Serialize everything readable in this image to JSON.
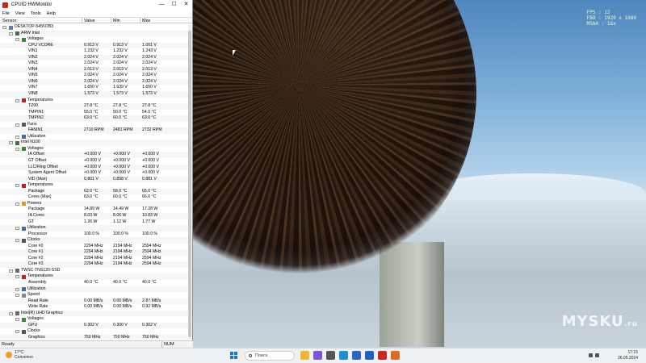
{
  "window": {
    "title": "CPUID HWMonitor"
  },
  "menu": [
    "File",
    "View",
    "Tools",
    "Help"
  ],
  "columns": [
    "Sensor",
    "Value",
    "Min",
    "Max"
  ],
  "tree": [
    {
      "level": 0,
      "type": "computer",
      "name": "DESKTOP-545N7B3"
    },
    {
      "level": 1,
      "type": "board",
      "name": "ARW Intel"
    },
    {
      "level": 2,
      "type": "volt",
      "name": "Voltages"
    },
    {
      "level": 3,
      "name": "CPU VCORE",
      "value": "0.913 V",
      "min": "0.913 V",
      "max": "1.001 V"
    },
    {
      "level": 3,
      "name": "VIN1",
      "value": "1.232 V",
      "min": "1.232 V",
      "max": "1.243 V"
    },
    {
      "level": 3,
      "name": "VIN2",
      "value": "2.024 V",
      "min": "2.024 V",
      "max": "2.024 V"
    },
    {
      "level": 3,
      "name": "VIN3",
      "value": "2.024 V",
      "min": "2.024 V",
      "max": "2.024 V"
    },
    {
      "level": 3,
      "name": "VIN4",
      "value": "2.013 V",
      "min": "2.013 V",
      "max": "2.013 V"
    },
    {
      "level": 3,
      "name": "VIN5",
      "value": "2.024 V",
      "min": "2.024 V",
      "max": "2.024 V"
    },
    {
      "level": 3,
      "name": "VIN6",
      "value": "2.024 V",
      "min": "2.024 V",
      "max": "2.024 V"
    },
    {
      "level": 3,
      "name": "VIN7",
      "value": "1.650 V",
      "min": "1.639 V",
      "max": "1.650 V"
    },
    {
      "level": 3,
      "name": "VIN8",
      "value": "1.573 V",
      "min": "1.573 V",
      "max": "1.573 V"
    },
    {
      "level": 2,
      "type": "temp",
      "name": "Temperatures"
    },
    {
      "level": 3,
      "name": "TZ00",
      "value": "27.8 °C",
      "min": "27.8 °C",
      "max": "27.8 °C"
    },
    {
      "level": 3,
      "name": "TMPIN1",
      "value": "55.0 °C",
      "min": "50.0 °C",
      "max": "54.0 °C"
    },
    {
      "level": 3,
      "name": "TMPIN2",
      "value": "63.0 °C",
      "min": "60.0 °C",
      "max": "63.0 °C"
    },
    {
      "level": 2,
      "type": "fan",
      "name": "Fans"
    },
    {
      "level": 3,
      "name": "FANIN1",
      "value": "2710 RPM",
      "min": "2481 RPM",
      "max": "2732 RPM"
    },
    {
      "level": 2,
      "type": "util",
      "name": "Utilization"
    },
    {
      "level": 1,
      "type": "cpu",
      "name": "Intel N100"
    },
    {
      "level": 2,
      "type": "volt",
      "name": "Voltages"
    },
    {
      "level": 3,
      "name": "IA Offset",
      "value": "+0.000 V",
      "min": "+0.000 V",
      "max": "+0.000 V"
    },
    {
      "level": 3,
      "name": "GT Offset",
      "value": "+0.000 V",
      "min": "+0.000 V",
      "max": "+0.000 V"
    },
    {
      "level": 3,
      "name": "LLC/Ring Offset",
      "value": "+0.000 V",
      "min": "+0.000 V",
      "max": "+0.000 V"
    },
    {
      "level": 3,
      "name": "System Agent Offset",
      "value": "+0.000 V",
      "min": "+0.000 V",
      "max": "+0.000 V"
    },
    {
      "level": 3,
      "name": "VID (Max)",
      "value": "0.801 V",
      "min": "0.898 V",
      "max": "0.881 V"
    },
    {
      "level": 2,
      "type": "temp",
      "name": "Temperatures"
    },
    {
      "level": 3,
      "name": "Package",
      "value": "62.0 °C",
      "min": "58.0 °C",
      "max": "65.0 °C"
    },
    {
      "level": 3,
      "name": "Cores (Max)",
      "value": "63.0 °C",
      "min": "60.0 °C",
      "max": "66.0 °C"
    },
    {
      "level": 2,
      "type": "power",
      "name": "Powers"
    },
    {
      "level": 3,
      "name": "Package",
      "value": "14.89 W",
      "min": "14.49 W",
      "max": "17.28 W"
    },
    {
      "level": 3,
      "name": "IA Cores",
      "value": "8.03 W",
      "min": "8.06 W",
      "max": "10.83 W"
    },
    {
      "level": 3,
      "name": "GT",
      "value": "1.26 W",
      "min": "1.12 W",
      "max": "1.77 W"
    },
    {
      "level": 2,
      "type": "util",
      "name": "Utilization"
    },
    {
      "level": 3,
      "name": "Processor",
      "value": "100.0 %",
      "min": "100.0 %",
      "max": "100.0 %"
    },
    {
      "level": 2,
      "type": "clock",
      "name": "Clocks"
    },
    {
      "level": 3,
      "name": "Core #0",
      "value": "2294 MHz",
      "min": "2194 MHz",
      "max": "2594 MHz"
    },
    {
      "level": 3,
      "name": "Core #1",
      "value": "2294 MHz",
      "min": "2194 MHz",
      "max": "2594 MHz"
    },
    {
      "level": 3,
      "name": "Core #2",
      "value": "2294 MHz",
      "min": "2194 MHz",
      "max": "2594 MHz"
    },
    {
      "level": 3,
      "name": "Core #3",
      "value": "2294 MHz",
      "min": "2194 MHz",
      "max": "2594 MHz"
    },
    {
      "level": 1,
      "type": "disk",
      "name": "TWSC-TNS120-SSD"
    },
    {
      "level": 2,
      "type": "temp",
      "name": "Temperatures"
    },
    {
      "level": 3,
      "name": "Assembly",
      "value": "40.0 °C",
      "min": "40.0 °C",
      "max": "40.0 °C"
    },
    {
      "level": 2,
      "type": "util",
      "name": "Utilization"
    },
    {
      "level": 2,
      "type": "speed",
      "name": "Speed"
    },
    {
      "level": 3,
      "name": "Read Rate",
      "value": "0.00 MB/s",
      "min": "0.00 MB/s",
      "max": "2.87 MB/s"
    },
    {
      "level": 3,
      "name": "Write Rate",
      "value": "0.00 MB/s",
      "min": "0.00 MB/s",
      "max": "0.92 MB/s"
    },
    {
      "level": 1,
      "type": "gpu",
      "name": "Intel(R) UHD Graphics"
    },
    {
      "level": 2,
      "type": "volt",
      "name": "Voltages"
    },
    {
      "level": 3,
      "name": "GPU",
      "value": "0.302 V",
      "min": "0.300 V",
      "max": "0.302 V"
    },
    {
      "level": 2,
      "type": "clock",
      "name": "Clocks"
    },
    {
      "level": 3,
      "name": "Graphics",
      "value": "750 MHz",
      "min": "750 MHz",
      "max": "750 MHz"
    }
  ],
  "status": {
    "left": "Ready",
    "right": "NUM"
  },
  "osd": {
    "line1": "FPS : 12",
    "line2": "FBO : 1920 x 1080",
    "line3": "MSAA : 16x"
  },
  "watermark": {
    "main": "MYSKU",
    "suffix": ".ru"
  },
  "taskbar": {
    "weather_temp": "17°C",
    "weather_desc": "Солнечно",
    "search_label": "Поиск",
    "time": "17:15",
    "date": "26.05.2024",
    "icons": [
      {
        "name": "file-explorer-icon",
        "color": "#f2b530"
      },
      {
        "name": "meet-icon",
        "color": "#7a56d8"
      },
      {
        "name": "taskview-icon",
        "color": "#555555"
      },
      {
        "name": "edge-icon",
        "color": "#1f8fd1"
      },
      {
        "name": "store-icon",
        "color": "#2a67c9"
      },
      {
        "name": "mail-icon",
        "color": "#2060c0"
      },
      {
        "name": "hwmonitor-icon",
        "color": "#d0261c"
      },
      {
        "name": "app-icon",
        "color": "#e06a20"
      }
    ]
  },
  "colors": {
    "hwmonitor_red": "#d0261c",
    "selection": "#f6f6f6"
  }
}
